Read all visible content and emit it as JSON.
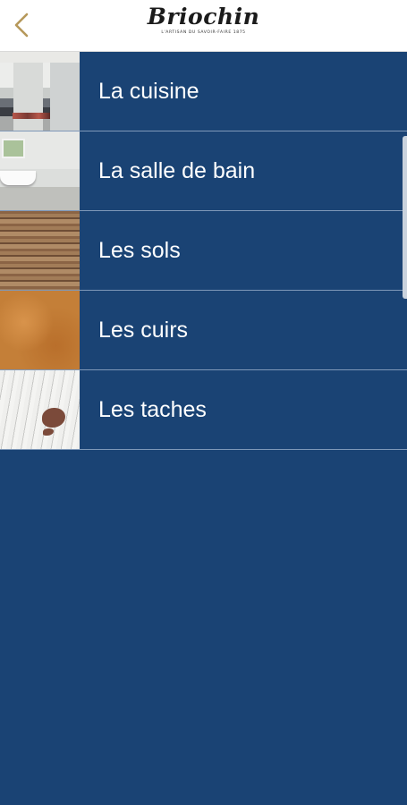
{
  "header": {
    "back_icon": "chevron-left-icon",
    "logo_text": "Briochin",
    "logo_tagline": "L'ARTISAN DU SAVOIR-FAIRE 1875"
  },
  "colors": {
    "accent": "#1a4374",
    "back_icon": "#b6985a"
  },
  "menu": {
    "items": [
      {
        "label": "La cuisine",
        "image": "kitchen-thumbnail"
      },
      {
        "label": "La salle de bain",
        "image": "bathroom-thumbnail"
      },
      {
        "label": "Les sols",
        "image": "wood-floor-thumbnail"
      },
      {
        "label": "Les cuirs",
        "image": "leather-thumbnail"
      },
      {
        "label": "Les taches",
        "image": "stain-thumbnail"
      }
    ]
  }
}
